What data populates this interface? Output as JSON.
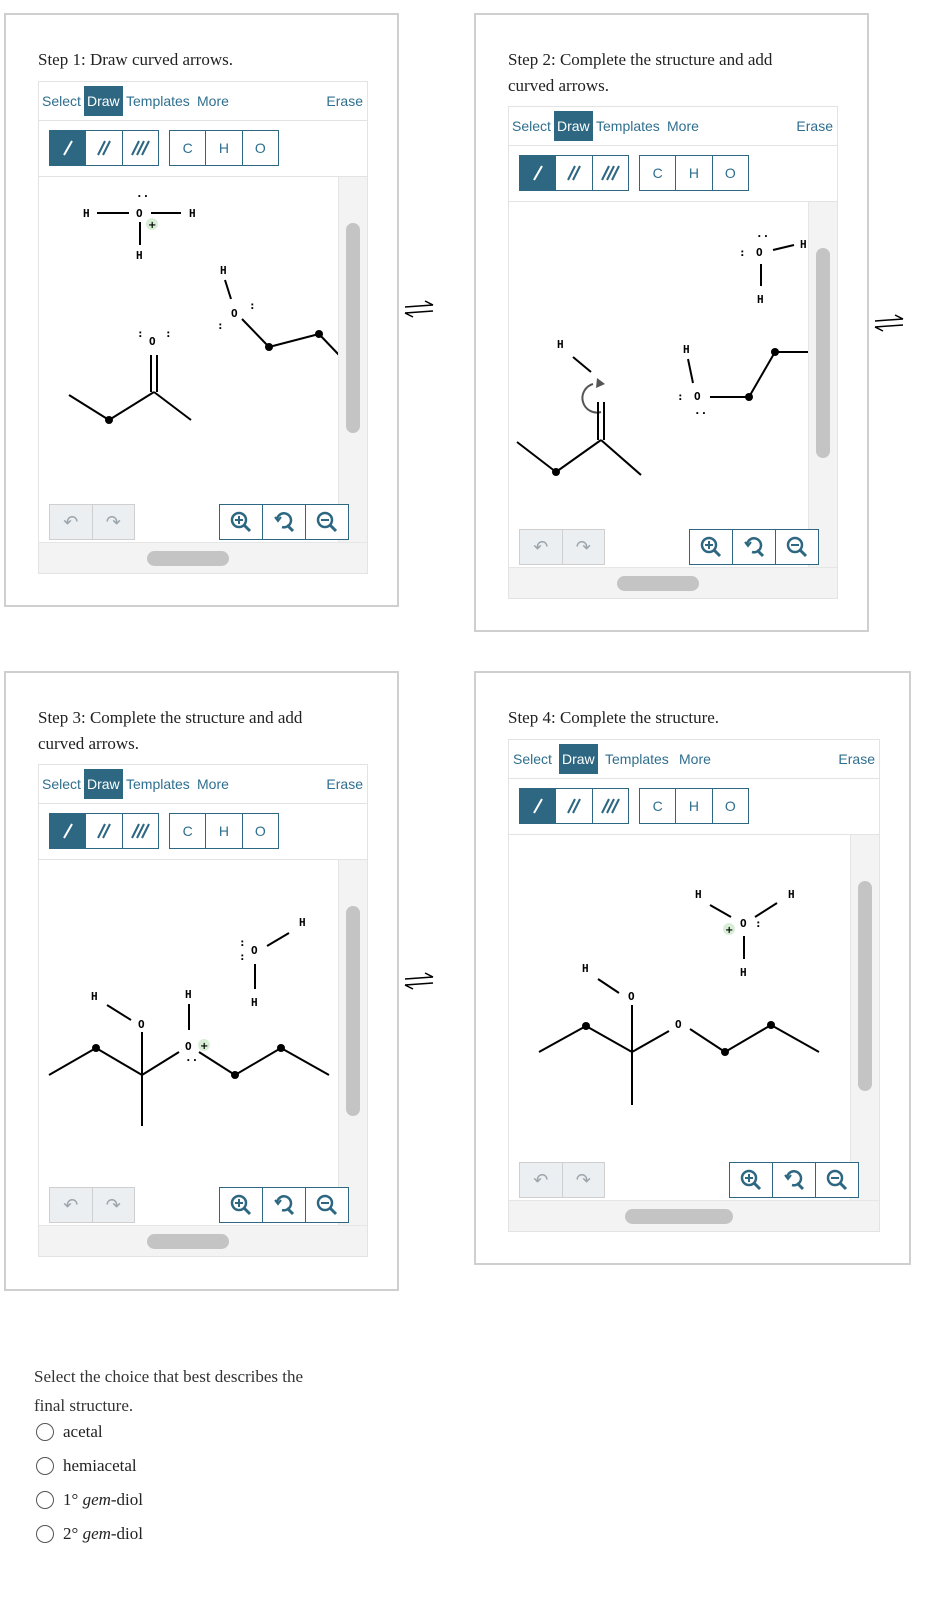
{
  "toolbar": {
    "select": "Select",
    "draw": "Draw",
    "templates": "Templates",
    "more": "More",
    "erase": "Erase",
    "atoms": [
      "C",
      "H",
      "O"
    ],
    "bond_icons": [
      "single-bond-icon",
      "double-bond-icon",
      "triple-bond-icon"
    ],
    "undo_icon": "undo-icon",
    "redo_icon": "redo-icon",
    "zoom_icons": [
      "zoom-in-icon",
      "zoom-reset-icon",
      "zoom-out-icon"
    ]
  },
  "steps": [
    {
      "title": "Step 1: Draw curved arrows."
    },
    {
      "title": "Step 2: Complete the structure and add curved arrows."
    },
    {
      "title": "Step 3: Complete the structure and add curved arrows."
    },
    {
      "title": "Step 4: Complete the structure."
    }
  ],
  "equilibrium_icon": "equilibrium-arrows-icon",
  "question": {
    "prompt": "Select the choice that best describes the final structure.",
    "options": [
      {
        "label": "acetal"
      },
      {
        "label": "hemiacetal"
      },
      {
        "label_prefix": "1° ",
        "label_em": "gem",
        "label_suffix": "-diol"
      },
      {
        "label_prefix": "2° ",
        "label_em": "gem",
        "label_suffix": "-diol"
      }
    ]
  },
  "colors": {
    "accent": "#2d6782",
    "charge_bg": "#d9eed6"
  }
}
